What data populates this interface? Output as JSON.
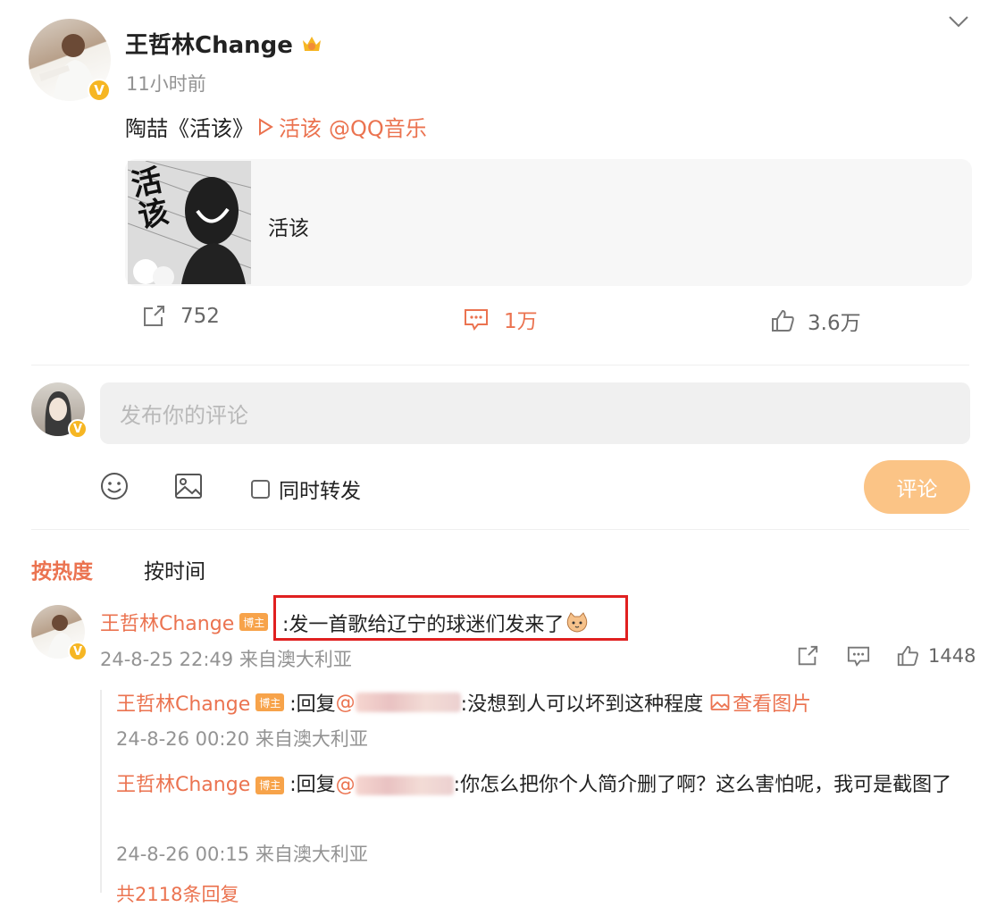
{
  "post": {
    "author": "王哲林Change",
    "time": "11小时前",
    "text_prefix": "陶喆《活该》",
    "music_link": "活该",
    "mention": "@QQ音乐",
    "card_title": "活该",
    "card_art_text": "活该",
    "actions": {
      "repost_count": "752",
      "comment_count": "1万",
      "like_count": "3.6万"
    }
  },
  "compose": {
    "placeholder": "发布你的评论",
    "repost_label": "同时转发",
    "submit_label": "评论"
  },
  "sort": {
    "hot_label": "按热度",
    "time_label": "按时间"
  },
  "comments": [
    {
      "author": "王哲林Change",
      "badge": "博主",
      "text": ":发一首歌给辽宁的球迷们发来了",
      "meta": "24-8-25 22:49 来自澳大利亚",
      "like_count": "1448",
      "replies": [
        {
          "author": "王哲林Change",
          "badge": "博主",
          "prefix": ":回复",
          "mention_start": "@",
          "text": ":没想到人可以坏到这种程度",
          "image_link": "查看图片",
          "meta": "24-8-26 00:20 来自澳大利亚"
        },
        {
          "author": "王哲林Change",
          "badge": "博主",
          "prefix": ":回复",
          "mention_start": "@",
          "text": ":你怎么把你个人简介删了啊？这么害怕呢，我可是截图了",
          "meta": "24-8-26 00:15 来自澳大利亚"
        }
      ],
      "more_replies": "共2118条回复"
    }
  ],
  "colors": {
    "accent": "#eb7350",
    "badge_gold": "#f6b623",
    "submit_button": "#fbc486",
    "highlight_box": "#e02020"
  }
}
